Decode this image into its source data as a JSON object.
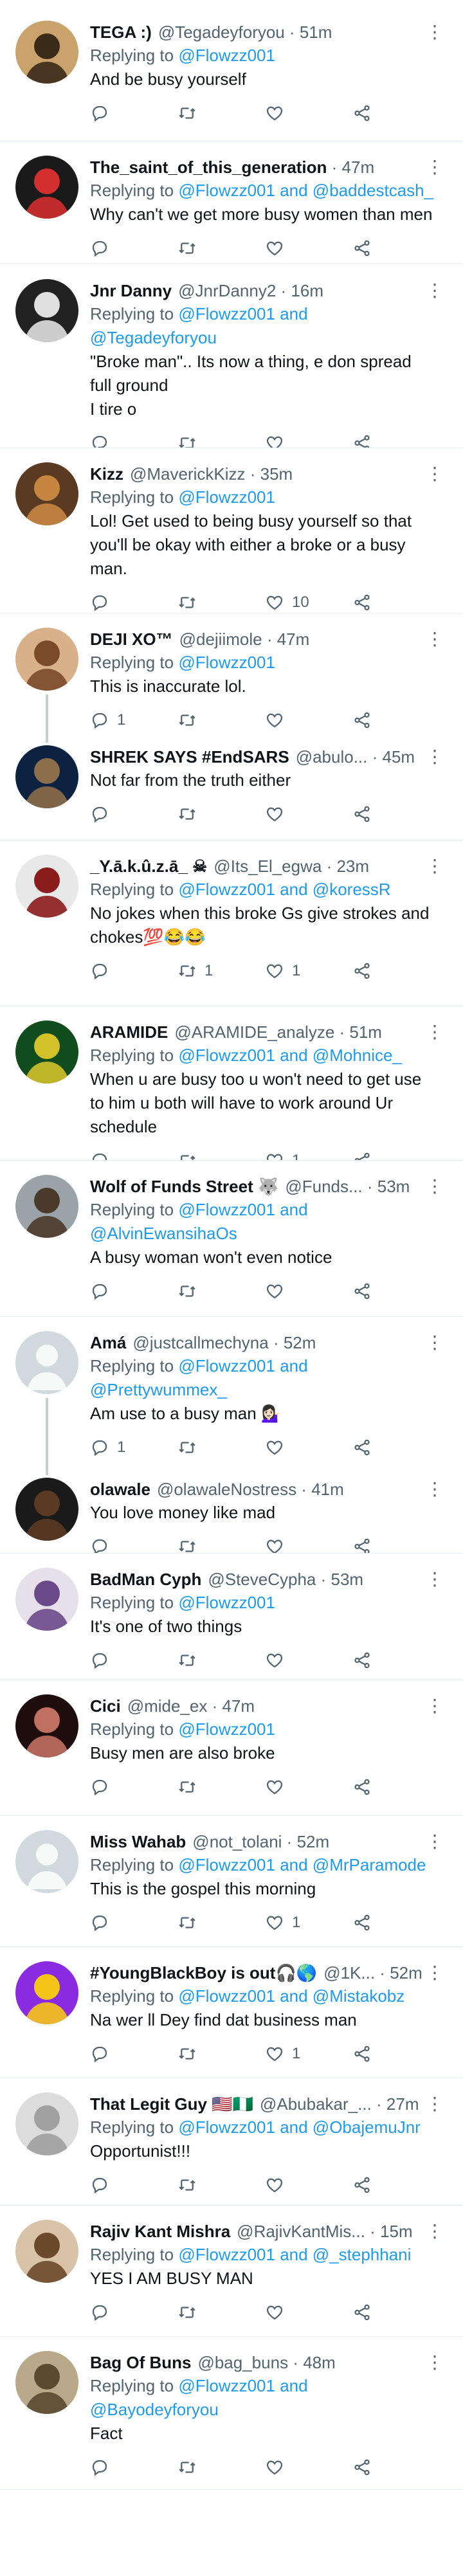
{
  "colors": {
    "link": "#1d9bf0",
    "muted": "#536471",
    "text": "#0f1419",
    "divider": "#e6ecf0",
    "thread": "#c4cfd6"
  },
  "icons": {
    "reply": "reply-icon",
    "retweet": "retweet-icon",
    "like": "like-icon",
    "share": "share-icon",
    "more": "more-icon"
  },
  "tweets": [
    {
      "name": "TEGA :)",
      "handle": "@Tegadeyforyou",
      "time": "51m",
      "reply_prefix": "Replying to",
      "reply_to": "@Flowzz001",
      "text": [
        "And be busy yourself"
      ],
      "retweets": "",
      "likes": "",
      "comments": ""
    },
    {
      "name": "The_saint_of_this_generation",
      "handle": "",
      "time": "47m",
      "reply_prefix": "Replying to",
      "reply_to": "@Flowzz001 and @baddestcash_",
      "text": [
        "Why can't we get more busy women than men"
      ],
      "retweets": "",
      "likes": "",
      "comments": ""
    },
    {
      "name": "Jnr Danny",
      "handle": "@JnrDanny2",
      "time": "16m",
      "reply_prefix": "Replying to",
      "reply_to": "@Flowzz001 and",
      "reply_to_2": "@Tegadeyforyou",
      "text": [
        "\"Broke man\".. Its now a thing, e don spread",
        "full ground",
        "I tire o"
      ],
      "retweets": "",
      "likes": "",
      "comments": ""
    },
    {
      "name": "Kizz",
      "handle": "@MaverickKizz",
      "time": "35m",
      "reply_prefix": "Replying to",
      "reply_to": "@Flowzz001",
      "text": [
        "Lol! Get used to being busy yourself so that",
        "you'll be okay with either a broke or a busy",
        "man."
      ],
      "retweets": "",
      "likes": "10",
      "comments": ""
    },
    {
      "name": "DEJI XO™",
      "handle": "@dejiimole",
      "time": "47m",
      "reply_prefix": "Replying to",
      "reply_to": "@Flowzz001",
      "text": [
        "This is inaccurate lol."
      ],
      "retweets": "",
      "likes": "",
      "comments": "1"
    },
    {
      "name": "SHREK SAYS #EndSARS",
      "handle": "@abulo...",
      "time": "45m",
      "reply_prefix": "",
      "reply_to": "",
      "text": [
        "Not far from the truth either"
      ],
      "retweets": "",
      "likes": "",
      "comments": ""
    },
    {
      "name": "_Y.ā.k.û.z.ā_ ☠",
      "handle": "@Its_El_egwa",
      "time": "23m",
      "reply_prefix": "Replying to",
      "reply_to": "@Flowzz001 and @koressR",
      "text": [
        "No jokes when this broke Gs give strokes and",
        "chokes💯😂😂"
      ],
      "retweets": "1",
      "likes": "1",
      "comments": ""
    },
    {
      "name": "ARAMIDE",
      "handle": "@ARAMIDE_analyze",
      "time": "51m",
      "reply_prefix": "Replying to",
      "reply_to": "@Flowzz001 and @Mohnice_",
      "text": [
        "When u are busy too u won't need to get use",
        "to him u both will have to work around Ur",
        "schedule"
      ],
      "retweets": "",
      "likes": "1",
      "comments": ""
    },
    {
      "name": "Wolf of Funds Street 🐺",
      "handle": "@Funds...",
      "time": "53m",
      "reply_prefix": "Replying to",
      "reply_to": "@Flowzz001 and",
      "reply_to_2": "@AlvinEwansihaOs",
      "text": [
        "A busy woman won't even notice"
      ],
      "retweets": "",
      "likes": "",
      "comments": ""
    },
    {
      "name": "Amá",
      "handle": "@justcallmechyna",
      "time": "52m",
      "reply_prefix": "Replying to",
      "reply_to": "@Flowzz001 and",
      "reply_to_2": "@Prettywummex_",
      "text": [
        "Am use to a busy man 💁🏻‍♀️"
      ],
      "retweets": "",
      "likes": "",
      "comments": "1"
    },
    {
      "name": "olawale",
      "handle": "@olawaleNostress",
      "time": "41m",
      "reply_prefix": "",
      "reply_to": "",
      "text": [
        "You love money like mad"
      ],
      "retweets": "",
      "likes": "",
      "comments": ""
    },
    {
      "name": "BadMan Cyph",
      "handle": "@SteveCypha",
      "time": "53m",
      "reply_prefix": "Replying to",
      "reply_to": "@Flowzz001",
      "text": [
        "It's one of two things"
      ],
      "retweets": "",
      "likes": "",
      "comments": ""
    },
    {
      "name": "Cici",
      "handle": "@mide_ex",
      "time": "47m",
      "reply_prefix": "Replying to",
      "reply_to": "@Flowzz001",
      "text": [
        "Busy men are also broke"
      ],
      "retweets": "",
      "likes": "",
      "comments": ""
    },
    {
      "name": "Miss Wahab",
      "handle": "@not_tolani",
      "time": "52m",
      "reply_prefix": "Replying to",
      "reply_to": "@Flowzz001 and @MrParamode",
      "text": [
        "This is the gospel this morning"
      ],
      "retweets": "",
      "likes": "1",
      "comments": ""
    },
    {
      "name": "#YoungBlackBoy is out🎧🌎",
      "handle": "@1K...",
      "time": "52m",
      "reply_prefix": "Replying to",
      "reply_to": "@Flowzz001 and @Mistakobz",
      "text": [
        "Na wer ll Dey find dat business man"
      ],
      "retweets": "",
      "likes": "1",
      "comments": ""
    },
    {
      "name": "That Legit Guy 🇺🇸🇳🇬",
      "handle": "@Abubakar_...",
      "time": "27m",
      "reply_prefix": "Replying to",
      "reply_to": "@Flowzz001 and @ObajemuJnr",
      "text": [
        "Opportunist!!!"
      ],
      "retweets": "",
      "likes": "",
      "comments": ""
    },
    {
      "name": "Rajiv Kant Mishra",
      "handle": "@RajivKantMis...",
      "time": "15m",
      "reply_prefix": "Replying to",
      "reply_to": "@Flowzz001 and @_stephhani",
      "text": [
        "YES I AM BUSY MAN"
      ],
      "retweets": "",
      "likes": "",
      "comments": ""
    },
    {
      "name": "Bag Of Buns",
      "handle": "@bag_buns",
      "time": "48m",
      "reply_prefix": "Replying to",
      "reply_to": "@Flowzz001 and",
      "reply_to_2": "@Bayodeyforyou",
      "text": [
        "Fact"
      ],
      "retweets": "",
      "likes": "",
      "comments": ""
    }
  ]
}
